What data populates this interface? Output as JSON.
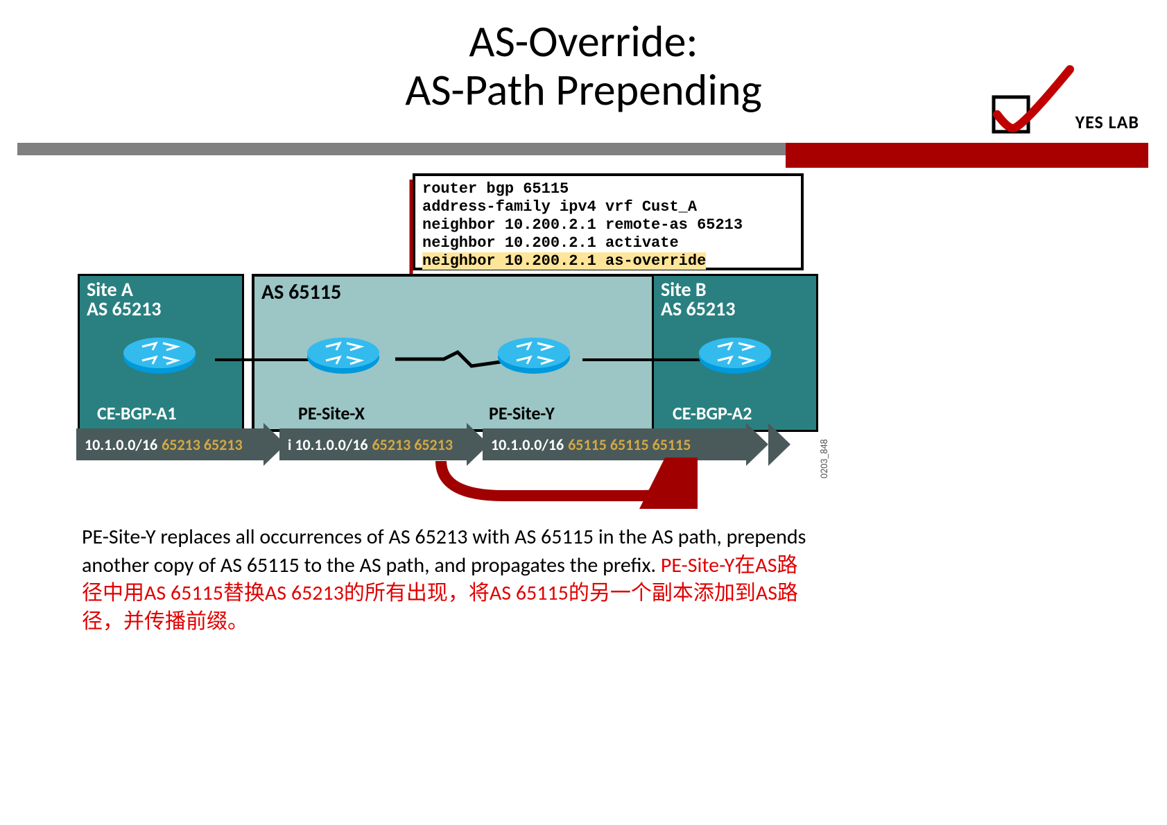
{
  "title_line1": "AS-Override:",
  "title_line2": "AS-Path Prepending",
  "logo_text": "YES LAB",
  "config": {
    "l1": "router bgp 65115",
    "l2": " address-family ipv4 vrf Cust_A",
    "l3": "  neighbor 10.200.2.1 remote-as 65213",
    "l4": "  neighbor 10.200.2.1 activate",
    "l5": "  neighbor 10.200.2.1 as-override"
  },
  "as_label": "AS 65115",
  "sites": {
    "a": {
      "name": "Site A",
      "asn": "AS 65213",
      "router": "CE-BGP-A1"
    },
    "b": {
      "name": "Site B",
      "asn": "AS 65213",
      "router": "CE-BGP-A2"
    }
  },
  "pe": {
    "x": "PE-Site-X",
    "y": "PE-Site-Y"
  },
  "flows": {
    "f1": {
      "pfx": "10.1.0.0/16",
      "asp": "65213 65213"
    },
    "f2": {
      "pfx": "i 10.1.0.0/16",
      "asp": "65213 65213"
    },
    "f3": {
      "pfx": "10.1.0.0/16",
      "asp": "65115 65115 65115"
    }
  },
  "fig_code": "0203_848",
  "desc_en": "PE-Site-Y replaces all occurrences of AS 65213 with AS 65115 in the AS path, prepends another copy of AS 65115 to the AS path, and propagates the prefix. ",
  "desc_zh": "PE-Site-Y在AS路径中用AS 65115替换AS 65213的所有出现，将AS 65115的另一个副本添加到AS路径，并传播前缀。"
}
